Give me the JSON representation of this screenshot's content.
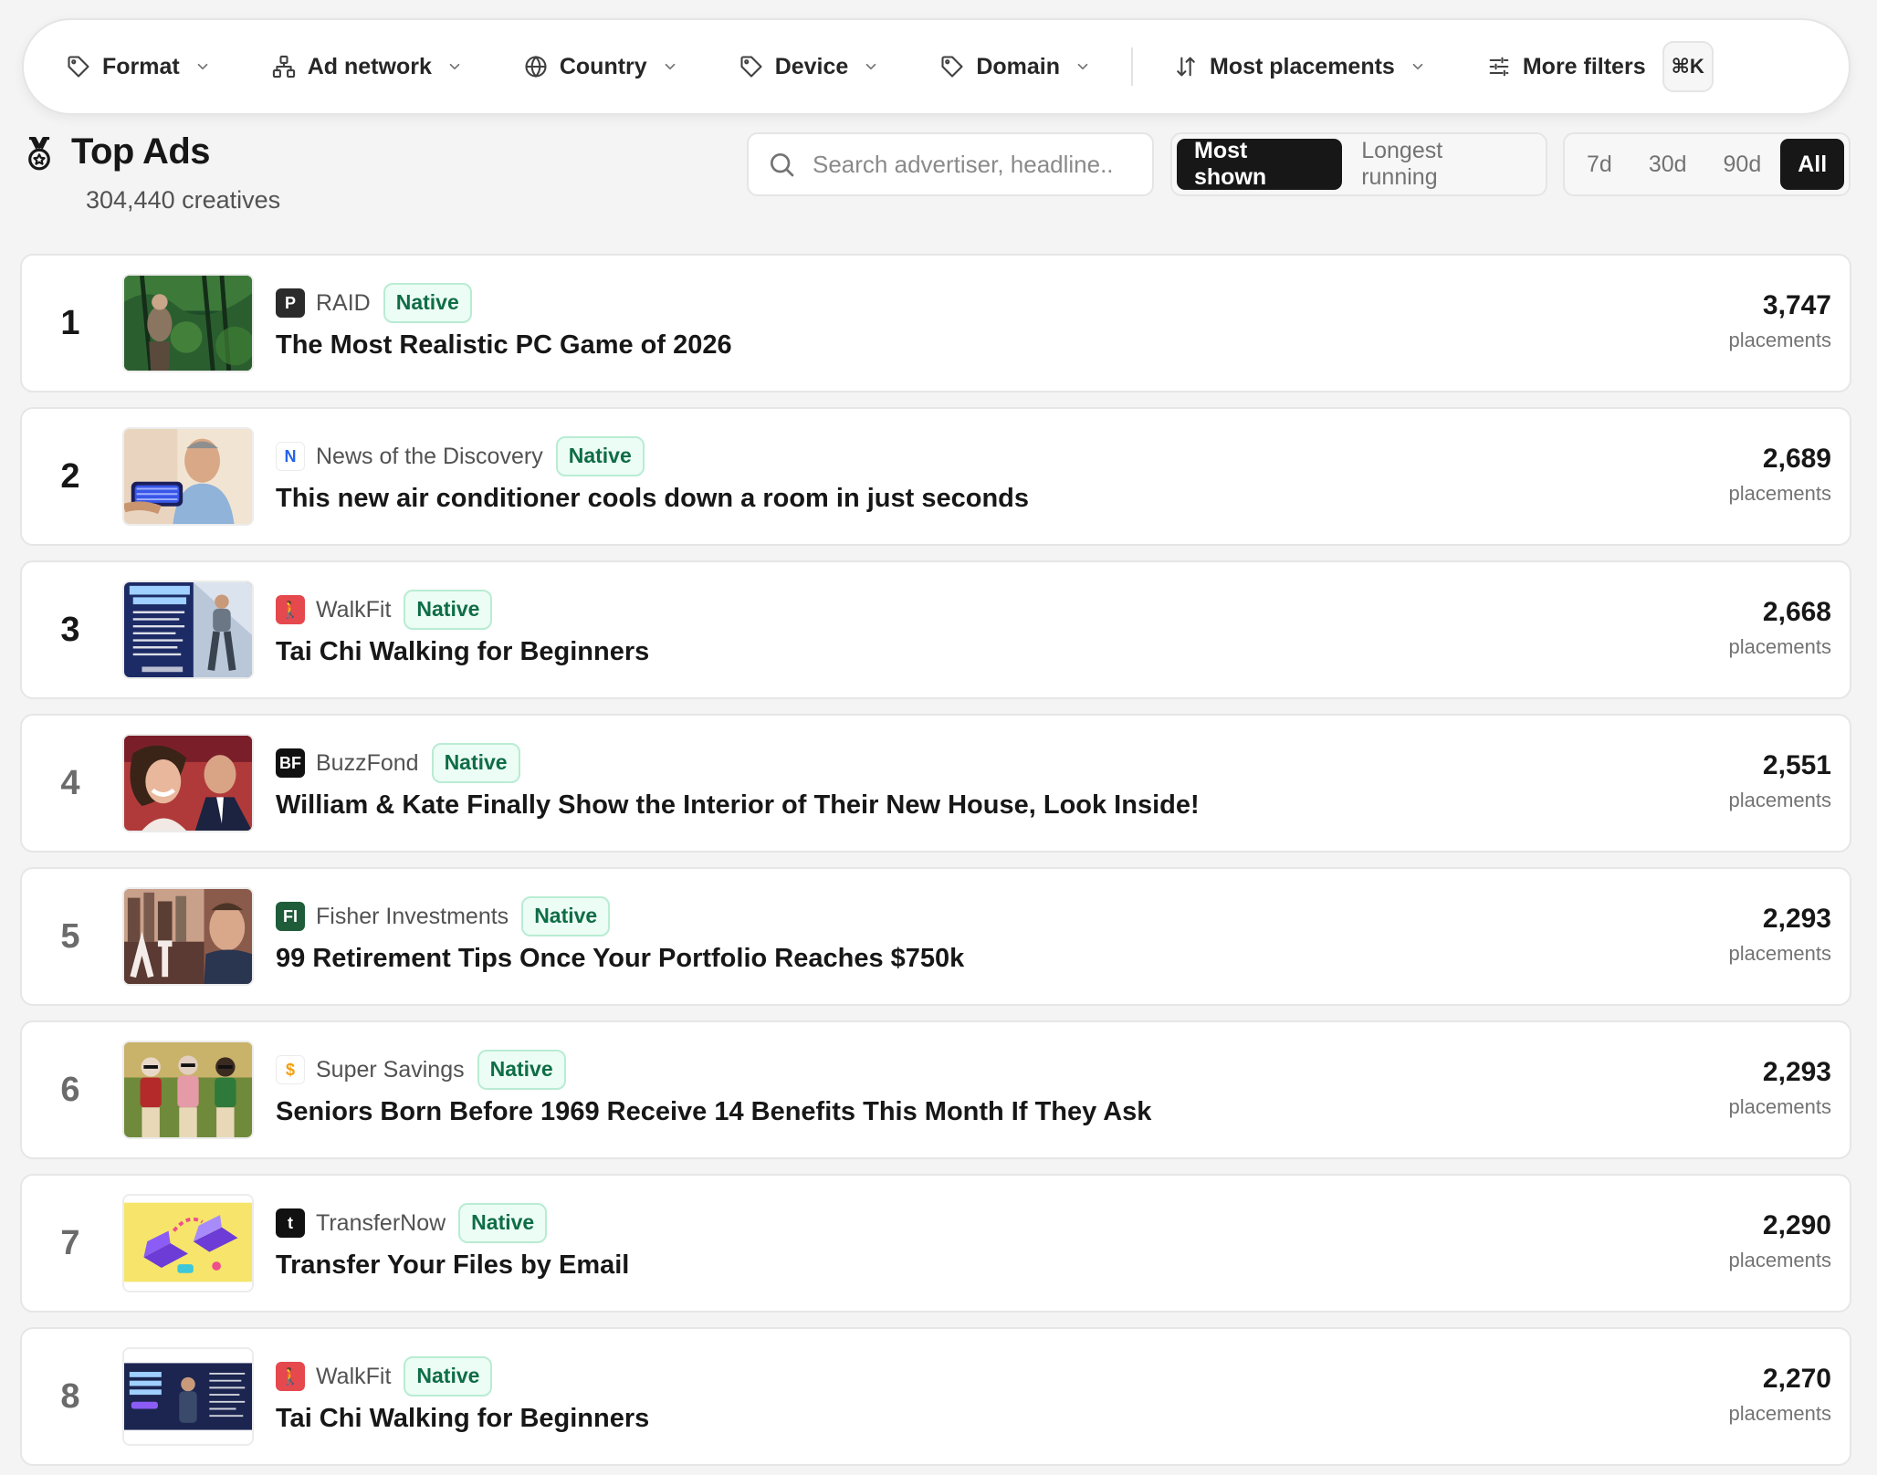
{
  "filters": {
    "items": [
      {
        "label": "Format",
        "icon": "tag-icon"
      },
      {
        "label": "Ad network",
        "icon": "network-icon"
      },
      {
        "label": "Country",
        "icon": "globe-icon"
      },
      {
        "label": "Device",
        "icon": "tag-icon"
      },
      {
        "label": "Domain",
        "icon": "tag-icon"
      }
    ],
    "sort_label": "Most placements",
    "more_label": "More filters",
    "shortcut": "⌘K"
  },
  "header": {
    "title": "Top Ads",
    "subtitle": "304,440 creatives"
  },
  "search": {
    "placeholder": "Search advertiser, headline..",
    "value": ""
  },
  "sort_toggle": {
    "options": [
      "Most shown",
      "Longest running"
    ],
    "selected": "Most shown"
  },
  "range_toggle": {
    "options": [
      "7d",
      "30d",
      "90d",
      "All"
    ],
    "selected": "All"
  },
  "colors": {
    "accent": "#171717",
    "badge_text": "#0f6d46",
    "badge_bg": "#ecfdf5"
  },
  "ads": [
    {
      "rank": "1",
      "advertiser": "RAID",
      "logo_text": "P",
      "logo_bg": "#2b2b2b",
      "logo_fg": "#ffffff",
      "format": "Native",
      "headline": "The Most Realistic PC Game of 2026",
      "placements": "3,747",
      "unit": "placements",
      "thumb": "jungle"
    },
    {
      "rank": "2",
      "advertiser": "News of the Discovery",
      "logo_text": "N",
      "logo_bg": "#ffffff",
      "logo_fg": "#2563eb",
      "format": "Native",
      "headline": "This new air conditioner cools down a room in just seconds",
      "placements": "2,689",
      "unit": "placements",
      "thumb": "aircon"
    },
    {
      "rank": "3",
      "advertiser": "WalkFit",
      "logo_text": "🚶",
      "logo_bg": "#e5484d",
      "logo_fg": "#ffffff",
      "format": "Native",
      "headline": "Tai Chi Walking for Beginners",
      "placements": "2,668",
      "unit": "placements",
      "thumb": "taichi"
    },
    {
      "rank": "4",
      "advertiser": "BuzzFond",
      "logo_text": "BF",
      "logo_bg": "#111111",
      "logo_fg": "#ffffff",
      "format": "Native",
      "headline": "William & Kate Finally Show the Interior of Their New House, Look Inside!",
      "placements": "2,551",
      "unit": "placements",
      "thumb": "royals"
    },
    {
      "rank": "5",
      "advertiser": "Fisher Investments",
      "logo_text": "FI",
      "logo_bg": "#1f5c3a",
      "logo_fg": "#ffffff",
      "format": "Native",
      "headline": "99 Retirement Tips Once Your Portfolio Reaches $750k",
      "placements": "2,293",
      "unit": "placements",
      "thumb": "city"
    },
    {
      "rank": "6",
      "advertiser": "Super Savings",
      "logo_text": "$",
      "logo_bg": "#ffffff",
      "logo_fg": "#f59e0b",
      "format": "Native",
      "headline": "Seniors Born Before 1969 Receive 14 Benefits This Month If They Ask",
      "placements": "2,293",
      "unit": "placements",
      "thumb": "seniors"
    },
    {
      "rank": "7",
      "advertiser": "TransferNow",
      "logo_text": "t",
      "logo_bg": "#111111",
      "logo_fg": "#ffffff",
      "format": "Native",
      "headline": "Transfer Your Files by Email",
      "placements": "2,290",
      "unit": "placements",
      "thumb": "transfer"
    },
    {
      "rank": "8",
      "advertiser": "WalkFit",
      "logo_text": "🚶",
      "logo_bg": "#e5484d",
      "logo_fg": "#ffffff",
      "format": "Native",
      "headline": "Tai Chi Walking for Beginners",
      "placements": "2,270",
      "unit": "placements",
      "thumb": "taichi2"
    }
  ]
}
